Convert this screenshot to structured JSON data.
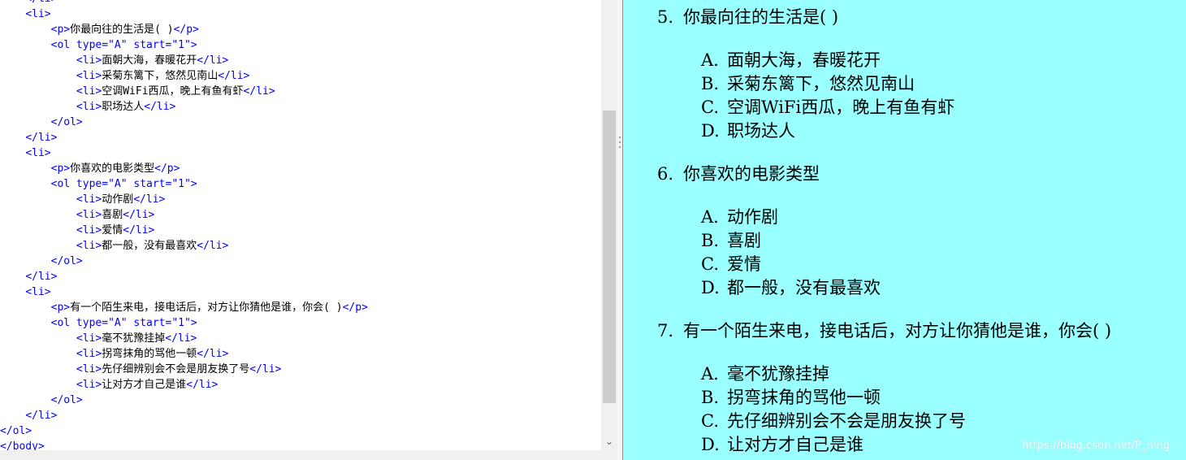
{
  "editor": {
    "lines": [
      {
        "indent": "    ",
        "parts": [
          {
            "t": "tag",
            "v": "</li>"
          }
        ]
      },
      {
        "indent": "    ",
        "parts": [
          {
            "t": "tag",
            "v": "<li>"
          }
        ]
      },
      {
        "indent": "        ",
        "parts": [
          {
            "t": "tag",
            "v": "<p>"
          },
          {
            "t": "txt",
            "v": "你最向往的生活是( )"
          },
          {
            "t": "tag",
            "v": "</p>"
          }
        ]
      },
      {
        "indent": "        ",
        "parts": [
          {
            "t": "tag",
            "v": "<ol type=\"A\" start=\"1\">"
          }
        ]
      },
      {
        "indent": "            ",
        "parts": [
          {
            "t": "tag",
            "v": "<li>"
          },
          {
            "t": "txt",
            "v": "面朝大海，春暖花开"
          },
          {
            "t": "tag",
            "v": "</li>"
          }
        ]
      },
      {
        "indent": "            ",
        "parts": [
          {
            "t": "tag",
            "v": "<li>"
          },
          {
            "t": "txt",
            "v": "采菊东篱下，悠然见南山"
          },
          {
            "t": "tag",
            "v": "</li>"
          }
        ]
      },
      {
        "indent": "            ",
        "parts": [
          {
            "t": "tag",
            "v": "<li>"
          },
          {
            "t": "txt",
            "v": "空调WiFi西瓜，晚上有鱼有虾"
          },
          {
            "t": "tag",
            "v": "</li>"
          }
        ]
      },
      {
        "indent": "            ",
        "parts": [
          {
            "t": "tag",
            "v": "<li>"
          },
          {
            "t": "txt",
            "v": "职场达人"
          },
          {
            "t": "tag",
            "v": "</li>"
          }
        ]
      },
      {
        "indent": "        ",
        "parts": [
          {
            "t": "tag",
            "v": "</ol>"
          }
        ]
      },
      {
        "indent": "    ",
        "parts": [
          {
            "t": "tag",
            "v": "</li>"
          }
        ]
      },
      {
        "indent": "    ",
        "parts": [
          {
            "t": "tag",
            "v": "<li>"
          }
        ]
      },
      {
        "indent": "        ",
        "parts": [
          {
            "t": "tag",
            "v": "<p>"
          },
          {
            "t": "txt",
            "v": "你喜欢的电影类型"
          },
          {
            "t": "tag",
            "v": "</p>"
          }
        ]
      },
      {
        "indent": "        ",
        "parts": [
          {
            "t": "tag",
            "v": "<ol type=\"A\" start=\"1\">"
          }
        ]
      },
      {
        "indent": "            ",
        "parts": [
          {
            "t": "tag",
            "v": "<li>"
          },
          {
            "t": "txt",
            "v": "动作剧"
          },
          {
            "t": "tag",
            "v": "</li>"
          }
        ]
      },
      {
        "indent": "            ",
        "parts": [
          {
            "t": "tag",
            "v": "<li>"
          },
          {
            "t": "txt",
            "v": "喜剧"
          },
          {
            "t": "tag",
            "v": "</li>"
          }
        ]
      },
      {
        "indent": "            ",
        "parts": [
          {
            "t": "tag",
            "v": "<li>"
          },
          {
            "t": "txt",
            "v": "爱情"
          },
          {
            "t": "tag",
            "v": "</li>"
          }
        ]
      },
      {
        "indent": "            ",
        "parts": [
          {
            "t": "tag",
            "v": "<li>"
          },
          {
            "t": "txt",
            "v": "都一般，没有最喜欢"
          },
          {
            "t": "tag",
            "v": "</li>"
          }
        ]
      },
      {
        "indent": "        ",
        "parts": [
          {
            "t": "tag",
            "v": "</ol>"
          }
        ]
      },
      {
        "indent": "    ",
        "parts": [
          {
            "t": "tag",
            "v": "</li>"
          }
        ]
      },
      {
        "indent": "    ",
        "parts": [
          {
            "t": "tag",
            "v": "<li>"
          }
        ]
      },
      {
        "indent": "        ",
        "parts": [
          {
            "t": "tag",
            "v": "<p>"
          },
          {
            "t": "txt",
            "v": "有一个陌生来电，接电话后，对方让你猜他是谁，你会( )"
          },
          {
            "t": "tag",
            "v": "</p>"
          }
        ]
      },
      {
        "indent": "        ",
        "parts": [
          {
            "t": "tag",
            "v": "<ol type=\"A\" start=\"1\">"
          }
        ]
      },
      {
        "indent": "            ",
        "parts": [
          {
            "t": "tag",
            "v": "<li>"
          },
          {
            "t": "txt",
            "v": "毫不犹豫挂掉"
          },
          {
            "t": "tag",
            "v": "</li>"
          }
        ]
      },
      {
        "indent": "            ",
        "parts": [
          {
            "t": "tag",
            "v": "<li>"
          },
          {
            "t": "txt",
            "v": "拐弯抹角的骂他一顿"
          },
          {
            "t": "tag",
            "v": "</li>"
          }
        ]
      },
      {
        "indent": "            ",
        "parts": [
          {
            "t": "tag",
            "v": "<li>"
          },
          {
            "t": "txt",
            "v": "先仔细辨别会不会是朋友换了号"
          },
          {
            "t": "tag",
            "v": "</li>"
          }
        ]
      },
      {
        "indent": "            ",
        "parts": [
          {
            "t": "tag",
            "v": "<li>"
          },
          {
            "t": "txt",
            "v": "让对方才自己是谁"
          },
          {
            "t": "tag",
            "v": "</li>"
          }
        ]
      },
      {
        "indent": "        ",
        "parts": [
          {
            "t": "tag",
            "v": "</ol>"
          }
        ]
      },
      {
        "indent": "    ",
        "parts": [
          {
            "t": "tag",
            "v": "</li>"
          }
        ]
      },
      {
        "indent": "",
        "parts": [
          {
            "t": "tag",
            "v": "</ol>"
          }
        ]
      },
      {
        "indent": "",
        "parts": [
          {
            "t": "tag",
            "v": "</body>"
          }
        ]
      }
    ]
  },
  "preview": {
    "questions": [
      {
        "num": "5.",
        "text": "你最向往的生活是( )",
        "options": [
          {
            "letter": "A.",
            "text": "面朝大海，春暖花开"
          },
          {
            "letter": "B.",
            "text": "采菊东篱下，悠然见南山"
          },
          {
            "letter": "C.",
            "text": "空调WiFi西瓜，晚上有鱼有虾"
          },
          {
            "letter": "D.",
            "text": "职场达人"
          }
        ]
      },
      {
        "num": "6.",
        "text": "你喜欢的电影类型",
        "options": [
          {
            "letter": "A.",
            "text": "动作剧"
          },
          {
            "letter": "B.",
            "text": "喜剧"
          },
          {
            "letter": "C.",
            "text": "爱情"
          },
          {
            "letter": "D.",
            "text": "都一般，没有最喜欢"
          }
        ]
      },
      {
        "num": "7.",
        "text": "有一个陌生来电，接电话后，对方让你猜他是谁，你会( )",
        "options": [
          {
            "letter": "A.",
            "text": "毫不犹豫挂掉"
          },
          {
            "letter": "B.",
            "text": "拐弯抹角的骂他一顿"
          },
          {
            "letter": "C.",
            "text": "先仔细辨别会不会是朋友换了号"
          },
          {
            "letter": "D.",
            "text": "让对方才自己是谁"
          }
        ]
      }
    ],
    "watermark": "https://blog.csdn.net/P_ning"
  },
  "colors": {
    "preview_bg": "#99ffff",
    "tag": "#0000ff"
  }
}
